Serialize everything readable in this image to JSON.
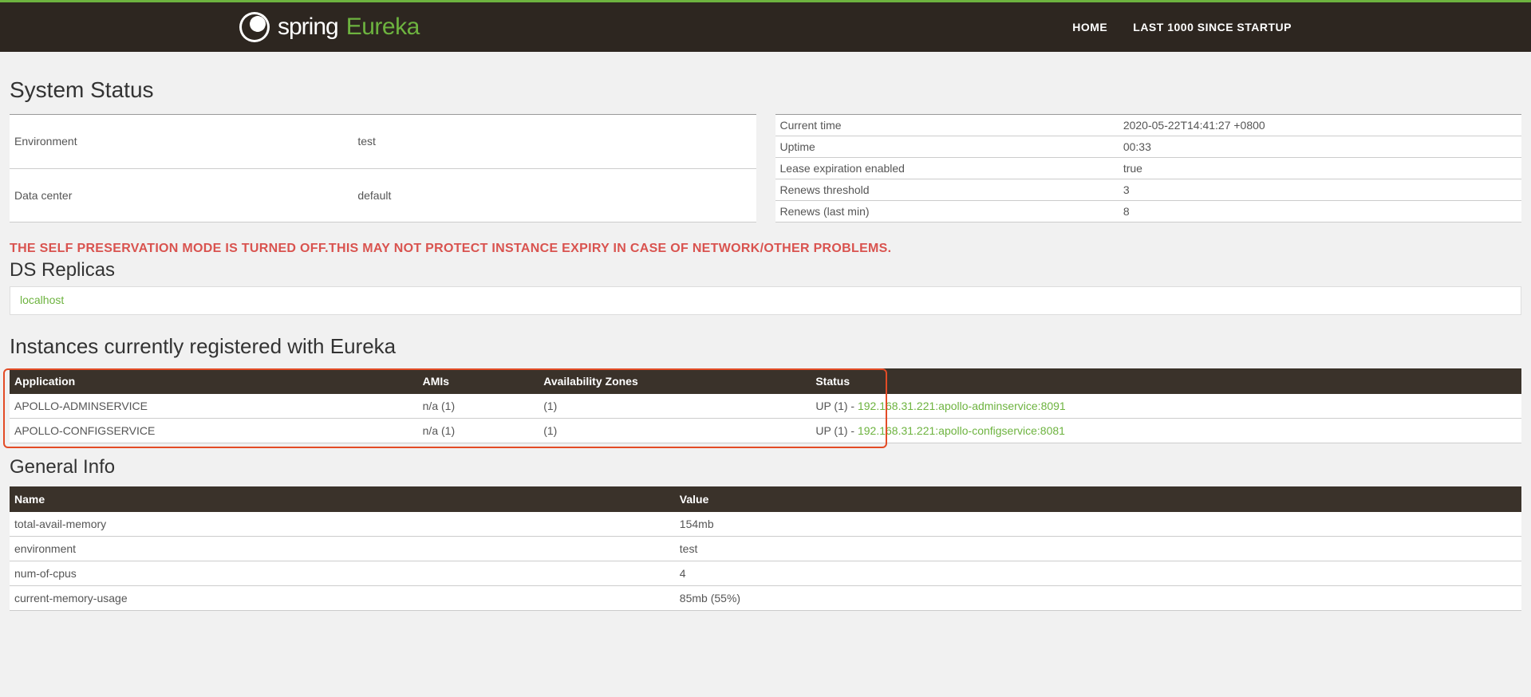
{
  "nav": {
    "brand_spring": "spring",
    "brand_eureka": "Eureka",
    "home": "HOME",
    "last1000": "LAST 1000 SINCE STARTUP"
  },
  "system_status": {
    "title": "System Status",
    "left": [
      {
        "label": "Environment",
        "value": "test"
      },
      {
        "label": "Data center",
        "value": "default"
      }
    ],
    "right": [
      {
        "label": "Current time",
        "value": "2020-05-22T14:41:27 +0800"
      },
      {
        "label": "Uptime",
        "value": "00:33"
      },
      {
        "label": "Lease expiration enabled",
        "value": "true"
      },
      {
        "label": "Renews threshold",
        "value": "3"
      },
      {
        "label": "Renews (last min)",
        "value": "8"
      }
    ]
  },
  "warning": "THE SELF PRESERVATION MODE IS TURNED OFF.THIS MAY NOT PROTECT INSTANCE EXPIRY IN CASE OF NETWORK/OTHER PROBLEMS.",
  "ds_replicas": {
    "title": "DS Replicas",
    "items": [
      "localhost"
    ]
  },
  "instances": {
    "title": "Instances currently registered with Eureka",
    "headers": {
      "app": "Application",
      "amis": "AMIs",
      "az": "Availability Zones",
      "status": "Status"
    },
    "rows": [
      {
        "app": "APOLLO-ADMINSERVICE",
        "amis": "n/a (1)",
        "az": "(1)",
        "status_prefix": "UP (1) - ",
        "status_link": "192.168.31.221:apollo-adminservice:8091"
      },
      {
        "app": "APOLLO-CONFIGSERVICE",
        "amis": "n/a (1)",
        "az": "(1)",
        "status_prefix": "UP (1) - ",
        "status_link": "192.168.31.221:apollo-configservice:8081"
      }
    ]
  },
  "general_info": {
    "title": "General Info",
    "headers": {
      "name": "Name",
      "value": "Value"
    },
    "rows": [
      {
        "name": "total-avail-memory",
        "value": "154mb"
      },
      {
        "name": "environment",
        "value": "test"
      },
      {
        "name": "num-of-cpus",
        "value": "4"
      },
      {
        "name": "current-memory-usage",
        "value": "85mb (55%)"
      }
    ]
  }
}
